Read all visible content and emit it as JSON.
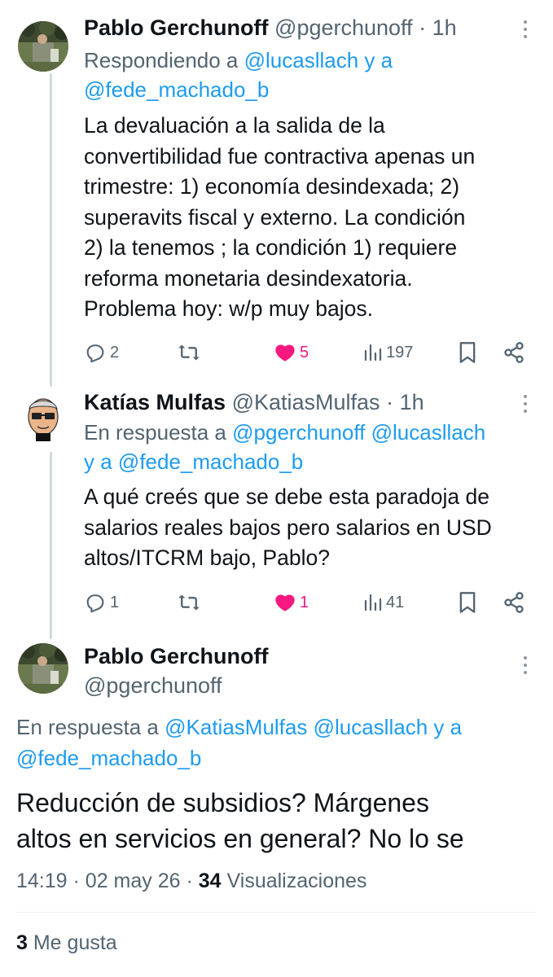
{
  "tweets": [
    {
      "author_name": "Pablo Gerchunoff",
      "handle": "@pgerchunoff",
      "time": "1h",
      "reply_prefix": "Respondiendo a",
      "reply_mention1": "@lucasllach",
      "reply_and": "y a",
      "reply_mention2": "@fede_machado_b",
      "text_lines": [
        "La devaluación a la salida de la",
        "convertibilidad fue contractiva apenas un",
        "trimestre: 1) economía desindexada; 2)",
        "superavits fiscal y externo. La  condición",
        "2) la tenemos ; la condición 1) requiere",
        "reforma monetaria desindexatoria.",
        "Problema hoy: w/p  muy bajos."
      ],
      "replies": "2",
      "likes": "5",
      "views": "197"
    },
    {
      "author_name": "Katías Mulfas",
      "handle": "@KatiasMulfas",
      "time": "1h",
      "reply_prefix": "En respuesta a",
      "reply_mention1": "@pgerchunoff",
      "reply_mention2": "@lucasllach",
      "reply_and": "y a",
      "reply_mention3": "@fede_machado_b",
      "text_lines": [
        "A qué creés que se debe esta paradoja de",
        "salarios reales bajos pero salarios en USD",
        "altos/ITCRM bajo, Pablo?"
      ],
      "replies": "1",
      "likes": "1",
      "views": "41"
    }
  ],
  "main": {
    "author_name": "Pablo Gerchunoff",
    "handle": "@pgerchunoff",
    "reply_prefix": "En respuesta a",
    "reply_mention1": "@KatiasMulfas",
    "reply_mention2": "@lucasllach",
    "reply_and": "y a",
    "reply_mention3": "@fede_machado_b",
    "text_lines": [
      "Reducción de subsidios?   Márgenes",
      "altos en servicios en general? No lo se"
    ],
    "time": "14:19",
    "date": "02 may 26",
    "views_count": "34",
    "views_label": "Visualizaciones",
    "likes_count": "3",
    "likes_label": "Me gusta"
  },
  "separator": "·",
  "colors": {
    "text": "#0f1419",
    "muted": "#536471",
    "link": "#1d9bf0",
    "like": "#f91880",
    "divider": "#eff3f4"
  }
}
